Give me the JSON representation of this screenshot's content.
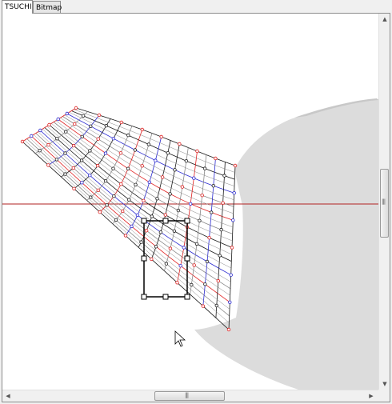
{
  "tabs": [
    {
      "label": "TSUCHI",
      "active": true
    },
    {
      "label": "Bitmap",
      "active": false
    }
  ],
  "scrollbars": {
    "up_arrow": "▲",
    "down_arrow": "▼",
    "left_arrow": "◀",
    "right_arrow": "▶",
    "grip": "|||"
  },
  "colors": {
    "background": "#ffffff",
    "silhouette": "#dcdcdc",
    "horizon_line": "#b22222",
    "mesh_black": "#1a1a1a",
    "mesh_gray": "#888888",
    "mesh_red": "#e02020",
    "mesh_blue": "#2a2ad0"
  }
}
